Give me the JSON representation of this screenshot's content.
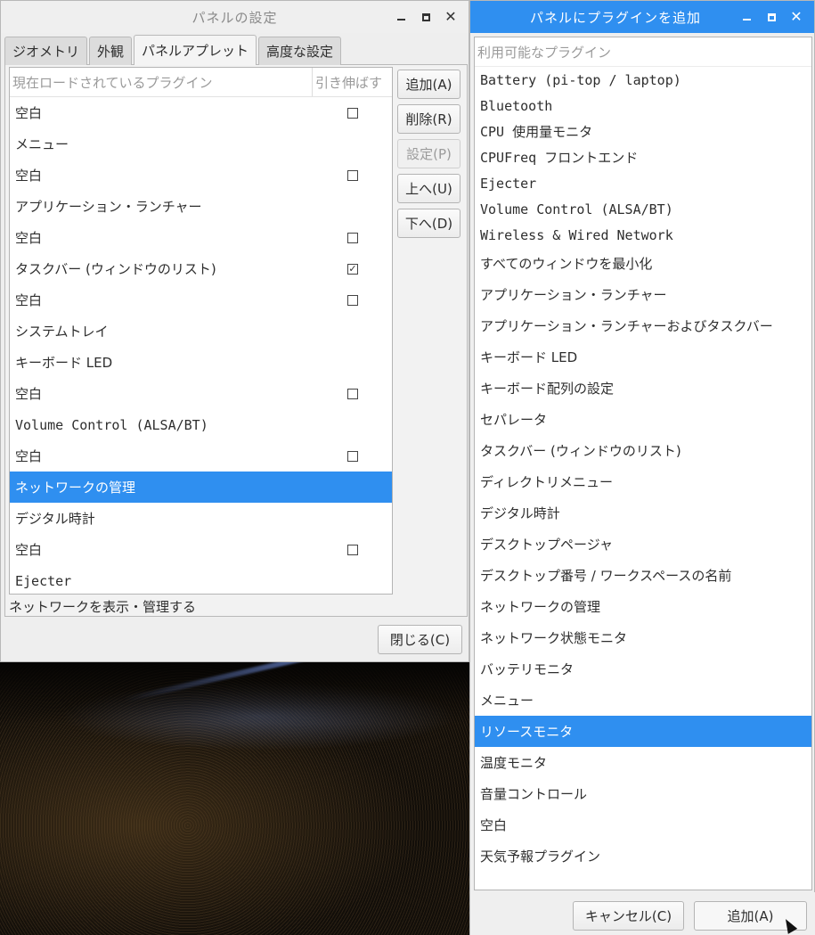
{
  "settings_window": {
    "title": "パネルの設定",
    "tabs": [
      "ジオメトリ",
      "外観",
      "パネルアプレット",
      "高度な設定"
    ],
    "active_tab": "パネルアプレット",
    "columns": {
      "name": "現在ロードされているプラグイン",
      "stretch": "引き伸ばす"
    },
    "plugins": [
      {
        "label": "空白",
        "stretch": false,
        "has_check": true
      },
      {
        "label": "メニュー",
        "has_check": false
      },
      {
        "label": "空白",
        "stretch": false,
        "has_check": true
      },
      {
        "label": "アプリケーション・ランチャー",
        "has_check": false
      },
      {
        "label": "空白",
        "stretch": false,
        "has_check": true
      },
      {
        "label": "タスクバー (ウィンドウのリスト)",
        "stretch": true,
        "has_check": true
      },
      {
        "label": "空白",
        "stretch": false,
        "has_check": true
      },
      {
        "label": "システムトレイ",
        "has_check": false
      },
      {
        "label": "キーボード LED",
        "has_check": false
      },
      {
        "label": "空白",
        "stretch": false,
        "has_check": true
      },
      {
        "label": "Volume Control (ALSA/BT)",
        "has_check": false
      },
      {
        "label": "空白",
        "stretch": false,
        "has_check": true
      },
      {
        "label": "ネットワークの管理",
        "has_check": false,
        "selected": true
      },
      {
        "label": "デジタル時計",
        "has_check": false
      },
      {
        "label": "空白",
        "stretch": false,
        "has_check": true
      },
      {
        "label": "Ejecter",
        "has_check": false
      }
    ],
    "buttons": {
      "add": "追加(A)",
      "remove": "削除(R)",
      "prefs": "設定(P)",
      "up": "上へ(U)",
      "down": "下へ(D)"
    },
    "description": "ネットワークを表示・管理する",
    "close": "閉じる(C)"
  },
  "add_window": {
    "title": "パネルにプラグインを追加",
    "column": "利用可能なプラグイン",
    "plugins": [
      "Battery (pi-top / laptop)",
      "Bluetooth",
      "CPU 使用量モニタ",
      "CPUFreq フロントエンド",
      "Ejecter",
      "Volume Control (ALSA/BT)",
      "Wireless & Wired Network",
      "すべてのウィンドウを最小化",
      "アプリケーション・ランチャー",
      "アプリケーション・ランチャーおよびタスクバー",
      "キーボード LED",
      "キーボード配列の設定",
      "セパレータ",
      "タスクバー (ウィンドウのリスト)",
      "ディレクトリメニュー",
      "デジタル時計",
      "デスクトップページャ",
      "デスクトップ番号 / ワークスペースの名前",
      "ネットワークの管理",
      "ネットワーク状態モニタ",
      "バッテリモニタ",
      "メニュー",
      "リソースモニタ",
      "温度モニタ",
      "音量コントロール",
      "空白",
      "天気予報プラグイン"
    ],
    "selected": "リソースモニタ",
    "cancel": "キャンセル(C)",
    "add": "追加(A)"
  },
  "colors": {
    "accent": "#2f8ff0"
  }
}
